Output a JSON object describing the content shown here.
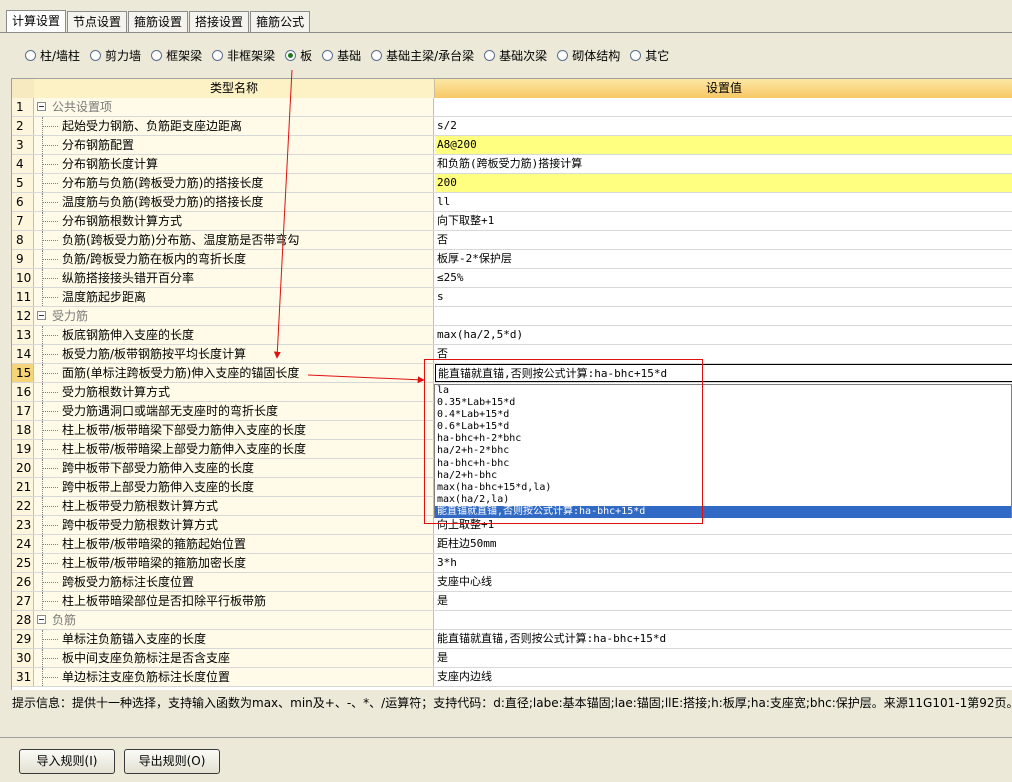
{
  "tabs": [
    "计算设置",
    "节点设置",
    "箍筋设置",
    "搭接设置",
    "箍筋公式"
  ],
  "radios": [
    "柱/墙柱",
    "剪力墙",
    "框架梁",
    "非框架梁",
    "板",
    "基础",
    "基础主梁/承台梁",
    "基础次梁",
    "砌体结构",
    "其它"
  ],
  "table": {
    "col_name": "类型名称",
    "col_value": "设置值",
    "rows": [
      {
        "n": "1",
        "name": "公共设置项",
        "value": "",
        "group": true
      },
      {
        "n": "2",
        "name": "起始受力钢筋、负筋距支座边距离",
        "value": "s/2"
      },
      {
        "n": "3",
        "name": "分布钢筋配置",
        "value": "A8@200",
        "yellow": true
      },
      {
        "n": "4",
        "name": "分布钢筋长度计算",
        "value": "和负筋(跨板受力筋)搭接计算"
      },
      {
        "n": "5",
        "name": "分布筋与负筋(跨板受力筋)的搭接长度",
        "value": "200",
        "yellow": true
      },
      {
        "n": "6",
        "name": "温度筋与负筋(跨板受力筋)的搭接长度",
        "value": "ll"
      },
      {
        "n": "7",
        "name": "分布钢筋根数计算方式",
        "value": "向下取整+1"
      },
      {
        "n": "8",
        "name": "负筋(跨板受力筋)分布筋、温度筋是否带弯勾",
        "value": "否"
      },
      {
        "n": "9",
        "name": "负筋/跨板受力筋在板内的弯折长度",
        "value": "板厚-2*保护层"
      },
      {
        "n": "10",
        "name": "纵筋搭接接头错开百分率",
        "value": "≤25%"
      },
      {
        "n": "11",
        "name": "温度筋起步距离",
        "value": "s"
      },
      {
        "n": "12",
        "name": "受力筋",
        "value": "",
        "group": true
      },
      {
        "n": "13",
        "name": "板底钢筋伸入支座的长度",
        "value": "max(ha/2,5*d)"
      },
      {
        "n": "14",
        "name": "板受力筋/板带钢筋按平均长度计算",
        "value": "否"
      },
      {
        "n": "15",
        "name": "面筋(单标注跨板受力筋)伸入支座的锚固长度",
        "value": "能直锚就直锚,否则按公式计算:ha-bhc+15*d",
        "sel": true
      },
      {
        "n": "16",
        "name": "受力筋根数计算方式",
        "value": ""
      },
      {
        "n": "17",
        "name": "受力筋遇洞口或端部无支座时的弯折长度",
        "value": ""
      },
      {
        "n": "18",
        "name": "柱上板带/板带暗梁下部受力筋伸入支座的长度",
        "value": ""
      },
      {
        "n": "19",
        "name": "柱上板带/板带暗梁上部受力筋伸入支座的长度",
        "value": ""
      },
      {
        "n": "20",
        "name": "跨中板带下部受力筋伸入支座的长度",
        "value": ""
      },
      {
        "n": "21",
        "name": "跨中板带上部受力筋伸入支座的长度",
        "value": ""
      },
      {
        "n": "22",
        "name": "柱上板带受力筋根数计算方式",
        "value": ""
      },
      {
        "n": "23",
        "name": "跨中板带受力筋根数计算方式",
        "value": "向上取整+1"
      },
      {
        "n": "24",
        "name": "柱上板带/板带暗梁的箍筋起始位置",
        "value": "距柱边50mm"
      },
      {
        "n": "25",
        "name": "柱上板带/板带暗梁的箍筋加密长度",
        "value": "3*h"
      },
      {
        "n": "26",
        "name": "跨板受力筋标注长度位置",
        "value": "支座中心线"
      },
      {
        "n": "27",
        "name": "柱上板带暗梁部位是否扣除平行板带筋",
        "value": "是"
      },
      {
        "n": "28",
        "name": "负筋",
        "value": "",
        "group": true
      },
      {
        "n": "29",
        "name": "单标注负筋锚入支座的长度",
        "value": "能直锚就直锚,否则按公式计算:ha-bhc+15*d"
      },
      {
        "n": "30",
        "name": "板中间支座负筋标注是否含支座",
        "value": "是"
      },
      {
        "n": "31",
        "name": "单边标注支座负筋标注长度位置",
        "value": "支座内边线"
      }
    ]
  },
  "dropdown": {
    "options": [
      "la",
      "0.35*Lab+15*d",
      "0.4*Lab+15*d",
      "0.6*Lab+15*d",
      "ha-bhc+h-2*bhc",
      "ha/2+h-2*bhc",
      "ha-bhc+h-bhc",
      "ha/2+h-bhc",
      "max(ha-bhc+15*d,la)",
      "max(ha/2,la)",
      "能直锚就直锚,否则按公式计算:ha-bhc+15*d"
    ],
    "selected_index": 10
  },
  "hint": "提示信息：提供十一种选择，支持输入函数为max、min及+、-、*、/运算符；支持代码：d:直径;labe:基本锚固;lae:锚固;llE:搭接;h:板厚;ha:支座宽;bhc:保护层。来源11G101-1第92页。",
  "buttons": {
    "import": "导入规则(I)",
    "export": "导出规则(O)"
  },
  "colors": {
    "annotation": "#e01010",
    "selection": "#316ac5",
    "highlight_cell": "#ffff80"
  }
}
